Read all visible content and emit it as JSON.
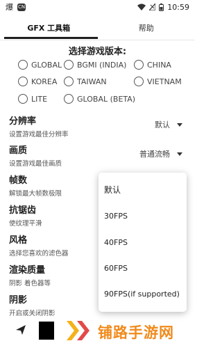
{
  "status_bar": {
    "left_icons": [
      "app-glyph-icon",
      "chat-badge-icon"
    ],
    "left_glyph": "爆",
    "badge_text": "CN",
    "time": "10:59"
  },
  "tabs": [
    {
      "label": "GFX 工具箱",
      "active": true
    },
    {
      "label": "帮助",
      "active": false
    }
  ],
  "version_section": {
    "title": "选择游戏版本:",
    "options": [
      "GLOBAL",
      "BGMI (INDIA)",
      "CHINA",
      "KOREA",
      "TAIWAN",
      "VIETNAM",
      "LITE",
      "GLOBAL (BETA)"
    ]
  },
  "settings": [
    {
      "title": "分辨率",
      "desc": "设置游戏最佳分辨率",
      "value": "默认"
    },
    {
      "title": "画质",
      "desc": "设置游戏最佳画质",
      "value": "普通流畅"
    },
    {
      "title": "帧数",
      "desc": "解锁最大帧数极限"
    },
    {
      "title": "抗锯齿",
      "desc": "使纹理平滑"
    },
    {
      "title": "风格",
      "desc": "选择您喜欢的滤色器"
    },
    {
      "title": "渲染质量",
      "desc": "阴影 着色器等"
    },
    {
      "title": "阴影",
      "desc": "开启或关闭阴影"
    }
  ],
  "fps_dropdown": {
    "options": [
      "默认",
      "30FPS",
      "40FPS",
      "60FPS",
      "90FPS(if supported)"
    ]
  },
  "bottom": {
    "watermark": "铺路手游网",
    "watermark_color": "#f08a1c"
  }
}
